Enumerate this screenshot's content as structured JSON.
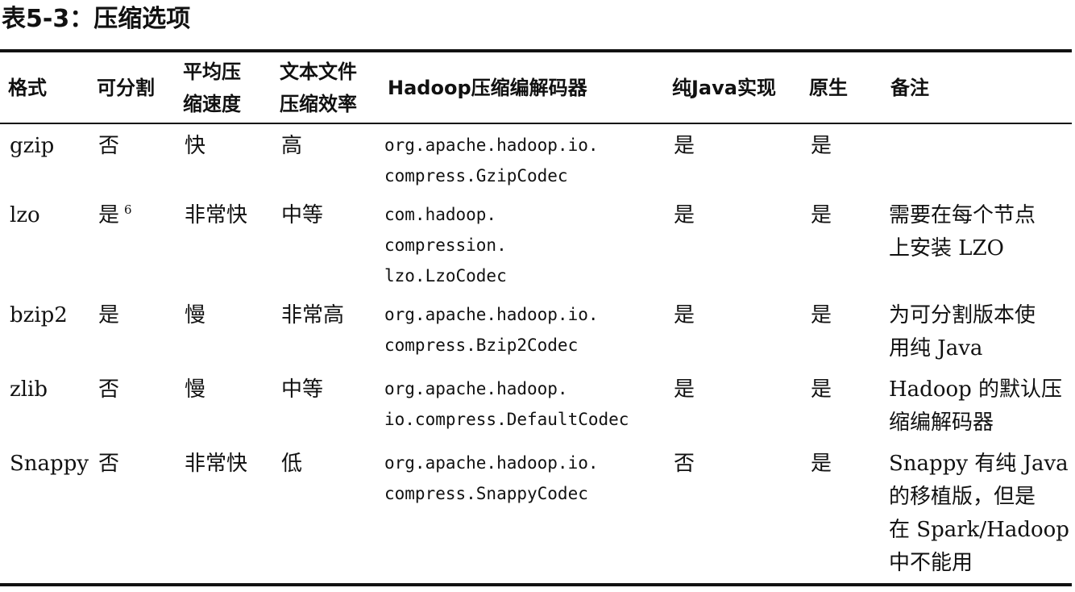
{
  "caption": "表5-3：压缩选项",
  "table": {
    "headers": [
      "格式",
      "可分割",
      "平均压\n缩速度",
      "文本文件\n压缩效率",
      "Hadoop压缩编解码器",
      "纯Java实现",
      "原生",
      "备注"
    ],
    "rows": [
      {
        "format": "gzip",
        "splittable": "否",
        "footnote": "",
        "speed": "快",
        "efficiency": "高",
        "codec": "org.apache.hadoop.io.\ncompress.GzipCodec",
        "pure_java": "是",
        "native": "是",
        "note": ""
      },
      {
        "format": "lzo",
        "splittable": "是",
        "footnote": "6",
        "speed": "非常快",
        "efficiency": "中等",
        "codec": "com.hadoop.\ncompression.\nlzo.LzoCodec",
        "pure_java": "是",
        "native": "是",
        "note": "需要在每个节点\n上安装 LZO"
      },
      {
        "format": "bzip2",
        "splittable": "是",
        "footnote": "",
        "speed": "慢",
        "efficiency": "非常高",
        "codec": "org.apache.hadoop.io.\ncompress.Bzip2Codec",
        "pure_java": "是",
        "native": "是",
        "note": "为可分割版本使\n用纯 Java"
      },
      {
        "format": "zlib",
        "splittable": "否",
        "footnote": "",
        "speed": "慢",
        "efficiency": "中等",
        "codec": "org.apache.hadoop.\nio.compress.DefaultCodec",
        "pure_java": "是",
        "native": "是",
        "note": "Hadoop 的默认压\n缩编解码器"
      },
      {
        "format": "Snappy",
        "splittable": "否",
        "footnote": "",
        "speed": "非常快",
        "efficiency": "低",
        "codec": "org.apache.hadoop.io.\ncompress.SnappyCodec",
        "pure_java": "否",
        "native": "是",
        "note": "Snappy 有纯 Java\n的移植版，但是\n在 Spark/Hadoop\n中不能用"
      }
    ]
  }
}
